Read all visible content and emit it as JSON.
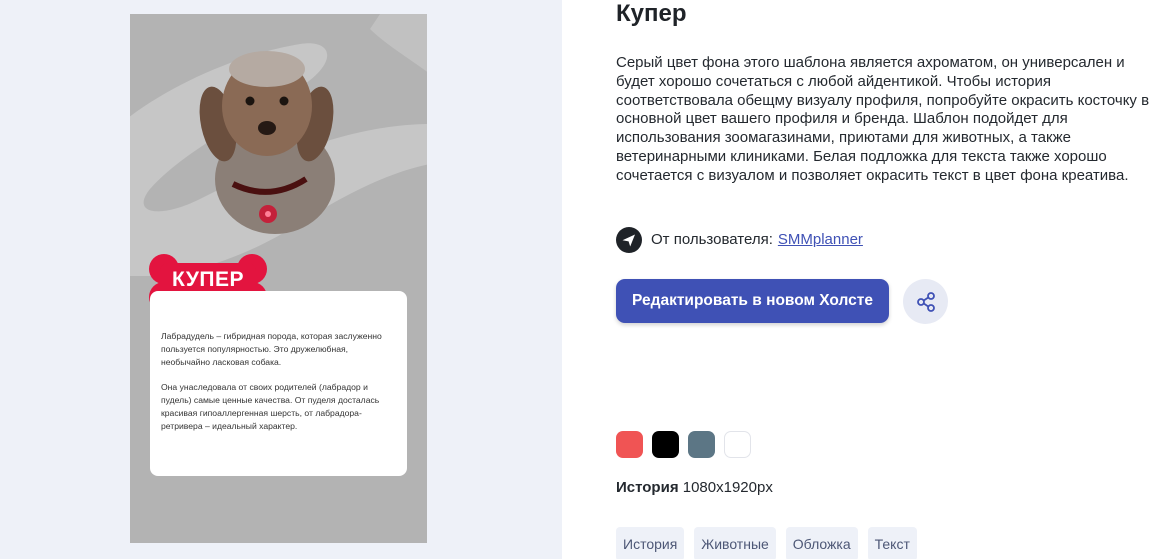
{
  "preview": {
    "bone_text": "КУПЕР",
    "paragraph1": "Лабрадудель – гибридная порода, которая заслуженно пользуется популярностью. Это дружелюбная, необычайно ласковая собака.",
    "paragraph2": "Она унаследовала от своих родителей (лабрадор и пудель) самые ценные качества. От пуделя досталась красивая гипоаллергенная шерсть, от лабрадора-ретривера – идеальный характер."
  },
  "template": {
    "title": "Купер",
    "description": "Серый цвет фона этого шаблона является ахроматом, он универсален и будет хорошо сочетаться с любой айдентикой. Чтобы история соответствовала обещму визуалу профиля, попробуйте окрасить косточку в основной цвет вашего профиля и бренда. Шаблон подойдет для использования зоомагазинами, приютами для животных, а также ветеринарными клиниками. Белая подложка для текста также хорошо сочетается с визуалом и позволяет окрасить текст в цвет фона креатива.",
    "author_prefix": "От пользователя:",
    "author_name": "SMMplanner",
    "author_icon": "send-arrow-icon",
    "edit_button": "Редактировать в новом Холсте",
    "share_icon": "share-icon",
    "format_label": "История",
    "format_size": "1080x1920px"
  },
  "palette": [
    "#f05454",
    "#000000",
    "#5c7685",
    "#ffffff"
  ],
  "tags": [
    "История",
    "Животные",
    "Обложка",
    "Текст"
  ]
}
